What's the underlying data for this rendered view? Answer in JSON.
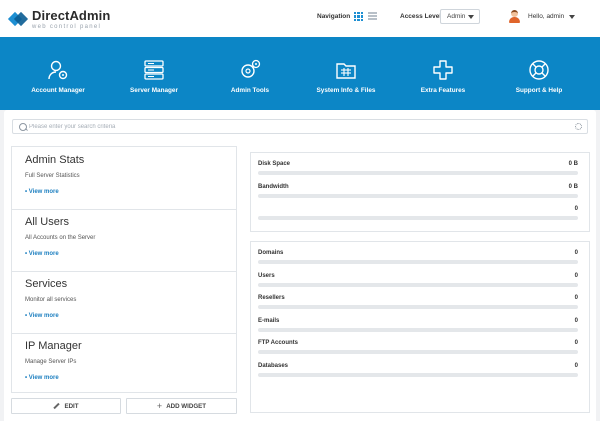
{
  "brand": {
    "name": "DirectAdmin",
    "tagline": "web control panel"
  },
  "header": {
    "navigation_label": "Navigation",
    "access_label": "Access Level",
    "access_value": "Admin",
    "greeting": "Hello,",
    "username": "admin"
  },
  "menu": [
    {
      "label": "Account Manager",
      "icon": "account-manager-icon"
    },
    {
      "label": "Server Manager",
      "icon": "server-icon"
    },
    {
      "label": "Admin Tools",
      "icon": "admin-tools-icon"
    },
    {
      "label": "System Info & Files",
      "icon": "folder-icon"
    },
    {
      "label": "Extra Features",
      "icon": "plus-icon"
    },
    {
      "label": "Support & Help",
      "icon": "lifebuoy-icon"
    }
  ],
  "search": {
    "placeholder": "Please enter your search criteria"
  },
  "widgets": [
    {
      "title": "Admin Stats",
      "subtitle": "Full Server Statistics",
      "link": "• View more"
    },
    {
      "title": "All Users",
      "subtitle": "All Accounts on the Server",
      "link": "• View more"
    },
    {
      "title": "Services",
      "subtitle": "Monitor all services",
      "link": "• View more"
    },
    {
      "title": "IP Manager",
      "subtitle": "Manage Server IPs",
      "link": "• View more"
    }
  ],
  "buttons": {
    "edit": "EDIT",
    "add_widget": "ADD WIDGET"
  },
  "usage": [
    {
      "label": "Disk Space",
      "value": "0 B",
      "fraction": 0
    },
    {
      "label": "Bandwidth",
      "value": "0 B",
      "fraction": 0
    },
    {
      "label": "",
      "value": "0",
      "fraction": 0
    }
  ],
  "counts": [
    {
      "label": "Domains",
      "value": "0",
      "fraction": 0
    },
    {
      "label": "Users",
      "value": "0",
      "fraction": 0
    },
    {
      "label": "Resellers",
      "value": "0",
      "fraction": 0
    },
    {
      "label": "E-mails",
      "value": "0",
      "fraction": 0
    },
    {
      "label": "FTP Accounts",
      "value": "0",
      "fraction": 0
    },
    {
      "label": "Databases",
      "value": "0",
      "fraction": 0
    }
  ],
  "colors": {
    "brand_blue": "#0c86c6",
    "link_blue": "#1c7fc0"
  }
}
